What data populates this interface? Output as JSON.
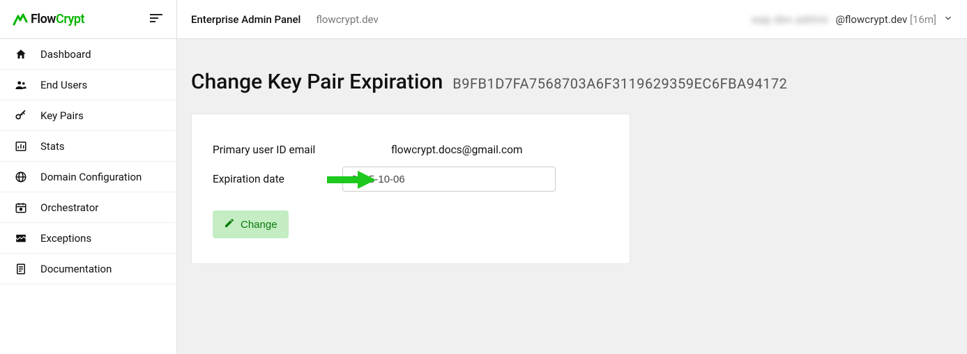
{
  "brand": {
    "flow": "Flow",
    "crypt": "Crypt"
  },
  "sidebar": {
    "items": [
      {
        "label": "Dashboard"
      },
      {
        "label": "End Users"
      },
      {
        "label": "Key Pairs"
      },
      {
        "label": "Stats"
      },
      {
        "label": "Domain Configuration"
      },
      {
        "label": "Orchestrator"
      },
      {
        "label": "Exceptions"
      },
      {
        "label": "Documentation"
      }
    ]
  },
  "topbar": {
    "title": "Enterprise Admin Panel",
    "domain": "flowcrypt.dev",
    "user_obscured": "eap.dev.admin",
    "user_domain": "@flowcrypt.dev",
    "session": "[16m]"
  },
  "page": {
    "title": "Change Key Pair Expiration",
    "key_fingerprint": "B9FB1D7FA7568703A6F3119629359EC6FBA94172"
  },
  "form": {
    "primary_label": "Primary user ID email",
    "primary_value": "flowcrypt.docs@gmail.com",
    "expiration_label": "Expiration date",
    "expiration_value": "2025-10-06",
    "change_label": "Change"
  },
  "annotation": {
    "arrow_color": "#1ec91e"
  }
}
